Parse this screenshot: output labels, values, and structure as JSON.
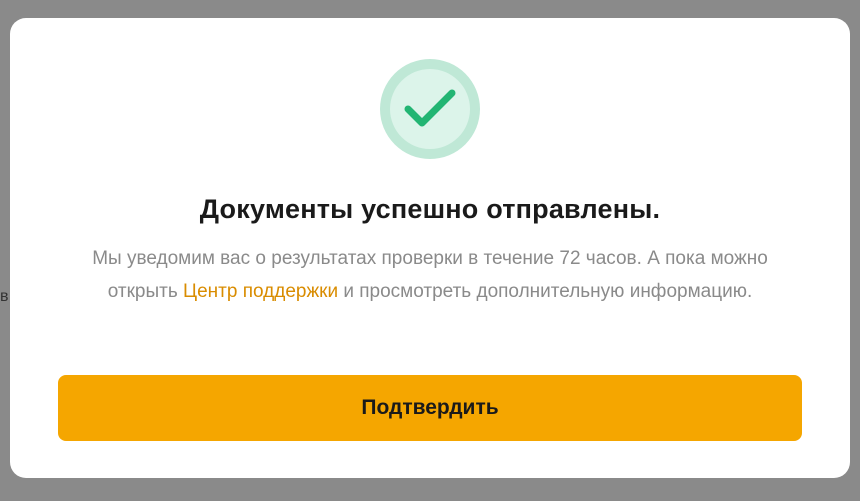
{
  "background": {
    "fragment_text": "в"
  },
  "modal": {
    "icon": "check-icon",
    "title": "Документы успешно отправлены.",
    "message": {
      "before_link": "Мы уведомим вас о результатах проверки в течение 72 часов. А пока можно открыть ",
      "link_label": "Центр поддержки",
      "after_link": " и просмотреть дополнительную информацию."
    },
    "confirm_label": "Подтвердить"
  },
  "colors": {
    "accent": "#f5a600",
    "link": "#d98c00",
    "success": "#22b573",
    "success_ring": "#bfe8d6"
  }
}
